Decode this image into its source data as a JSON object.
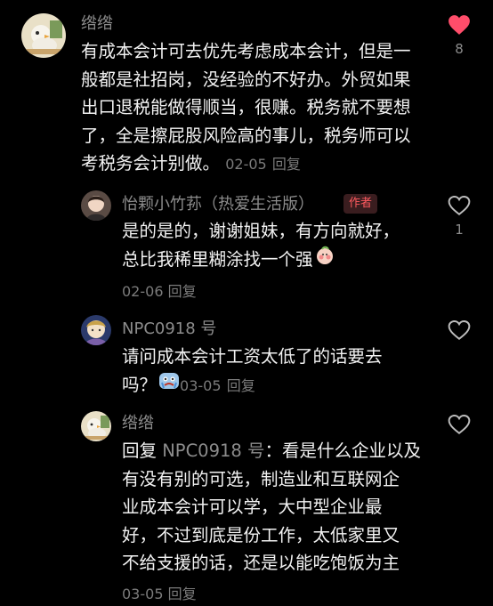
{
  "comments": [
    {
      "username": "绺绺",
      "lines": [
        "有成本会计可去优先考虑成本会计，但是一",
        "般都是社招岗，没经验的不好办。外贸如果",
        "出口退税能做得顺当，很赚。税务就不要想",
        "了，全是擦屁股风险高的事儿，税务师可以",
        "考税务会计别做。"
      ],
      "date": "02-05",
      "reply_label": "回复",
      "likes": "8",
      "liked": true
    },
    {
      "username": "怡颗小竹荪（热爱生活版）",
      "badge": "作者",
      "lines": [
        "是的是的，谢谢姐妹，有方向就好，",
        "总比我稀里糊涂找一个强"
      ],
      "date": "02-06",
      "reply_label": "回复",
      "likes": "1",
      "liked": false
    },
    {
      "username": "NPC0918 号",
      "lines": [
        "请问成本会计工资太低了的话要去",
        "吗？"
      ],
      "date": "03-05",
      "reply_label": "回复",
      "likes": "",
      "liked": false
    },
    {
      "username": "绺绺",
      "reply_prefix": "回复",
      "mention": "NPC0918 号",
      "lines": [
        "：看是什么企业以及",
        "有没有别的可选，制造业和互联网企",
        "业成本会计可以学，大中型企业最",
        "好，不过到底是份工作，太低家里又",
        "不给支援的话，还是以能吃饱饭为主"
      ],
      "date": "03-05",
      "reply_label": "回复",
      "likes": "",
      "liked": false
    }
  ],
  "colors": {
    "background": "#000000",
    "text": "#f2f2f2",
    "meta": "#7b7b7b",
    "like_active": "#ff4d6a",
    "author_badge_text": "#ff5a5f"
  }
}
